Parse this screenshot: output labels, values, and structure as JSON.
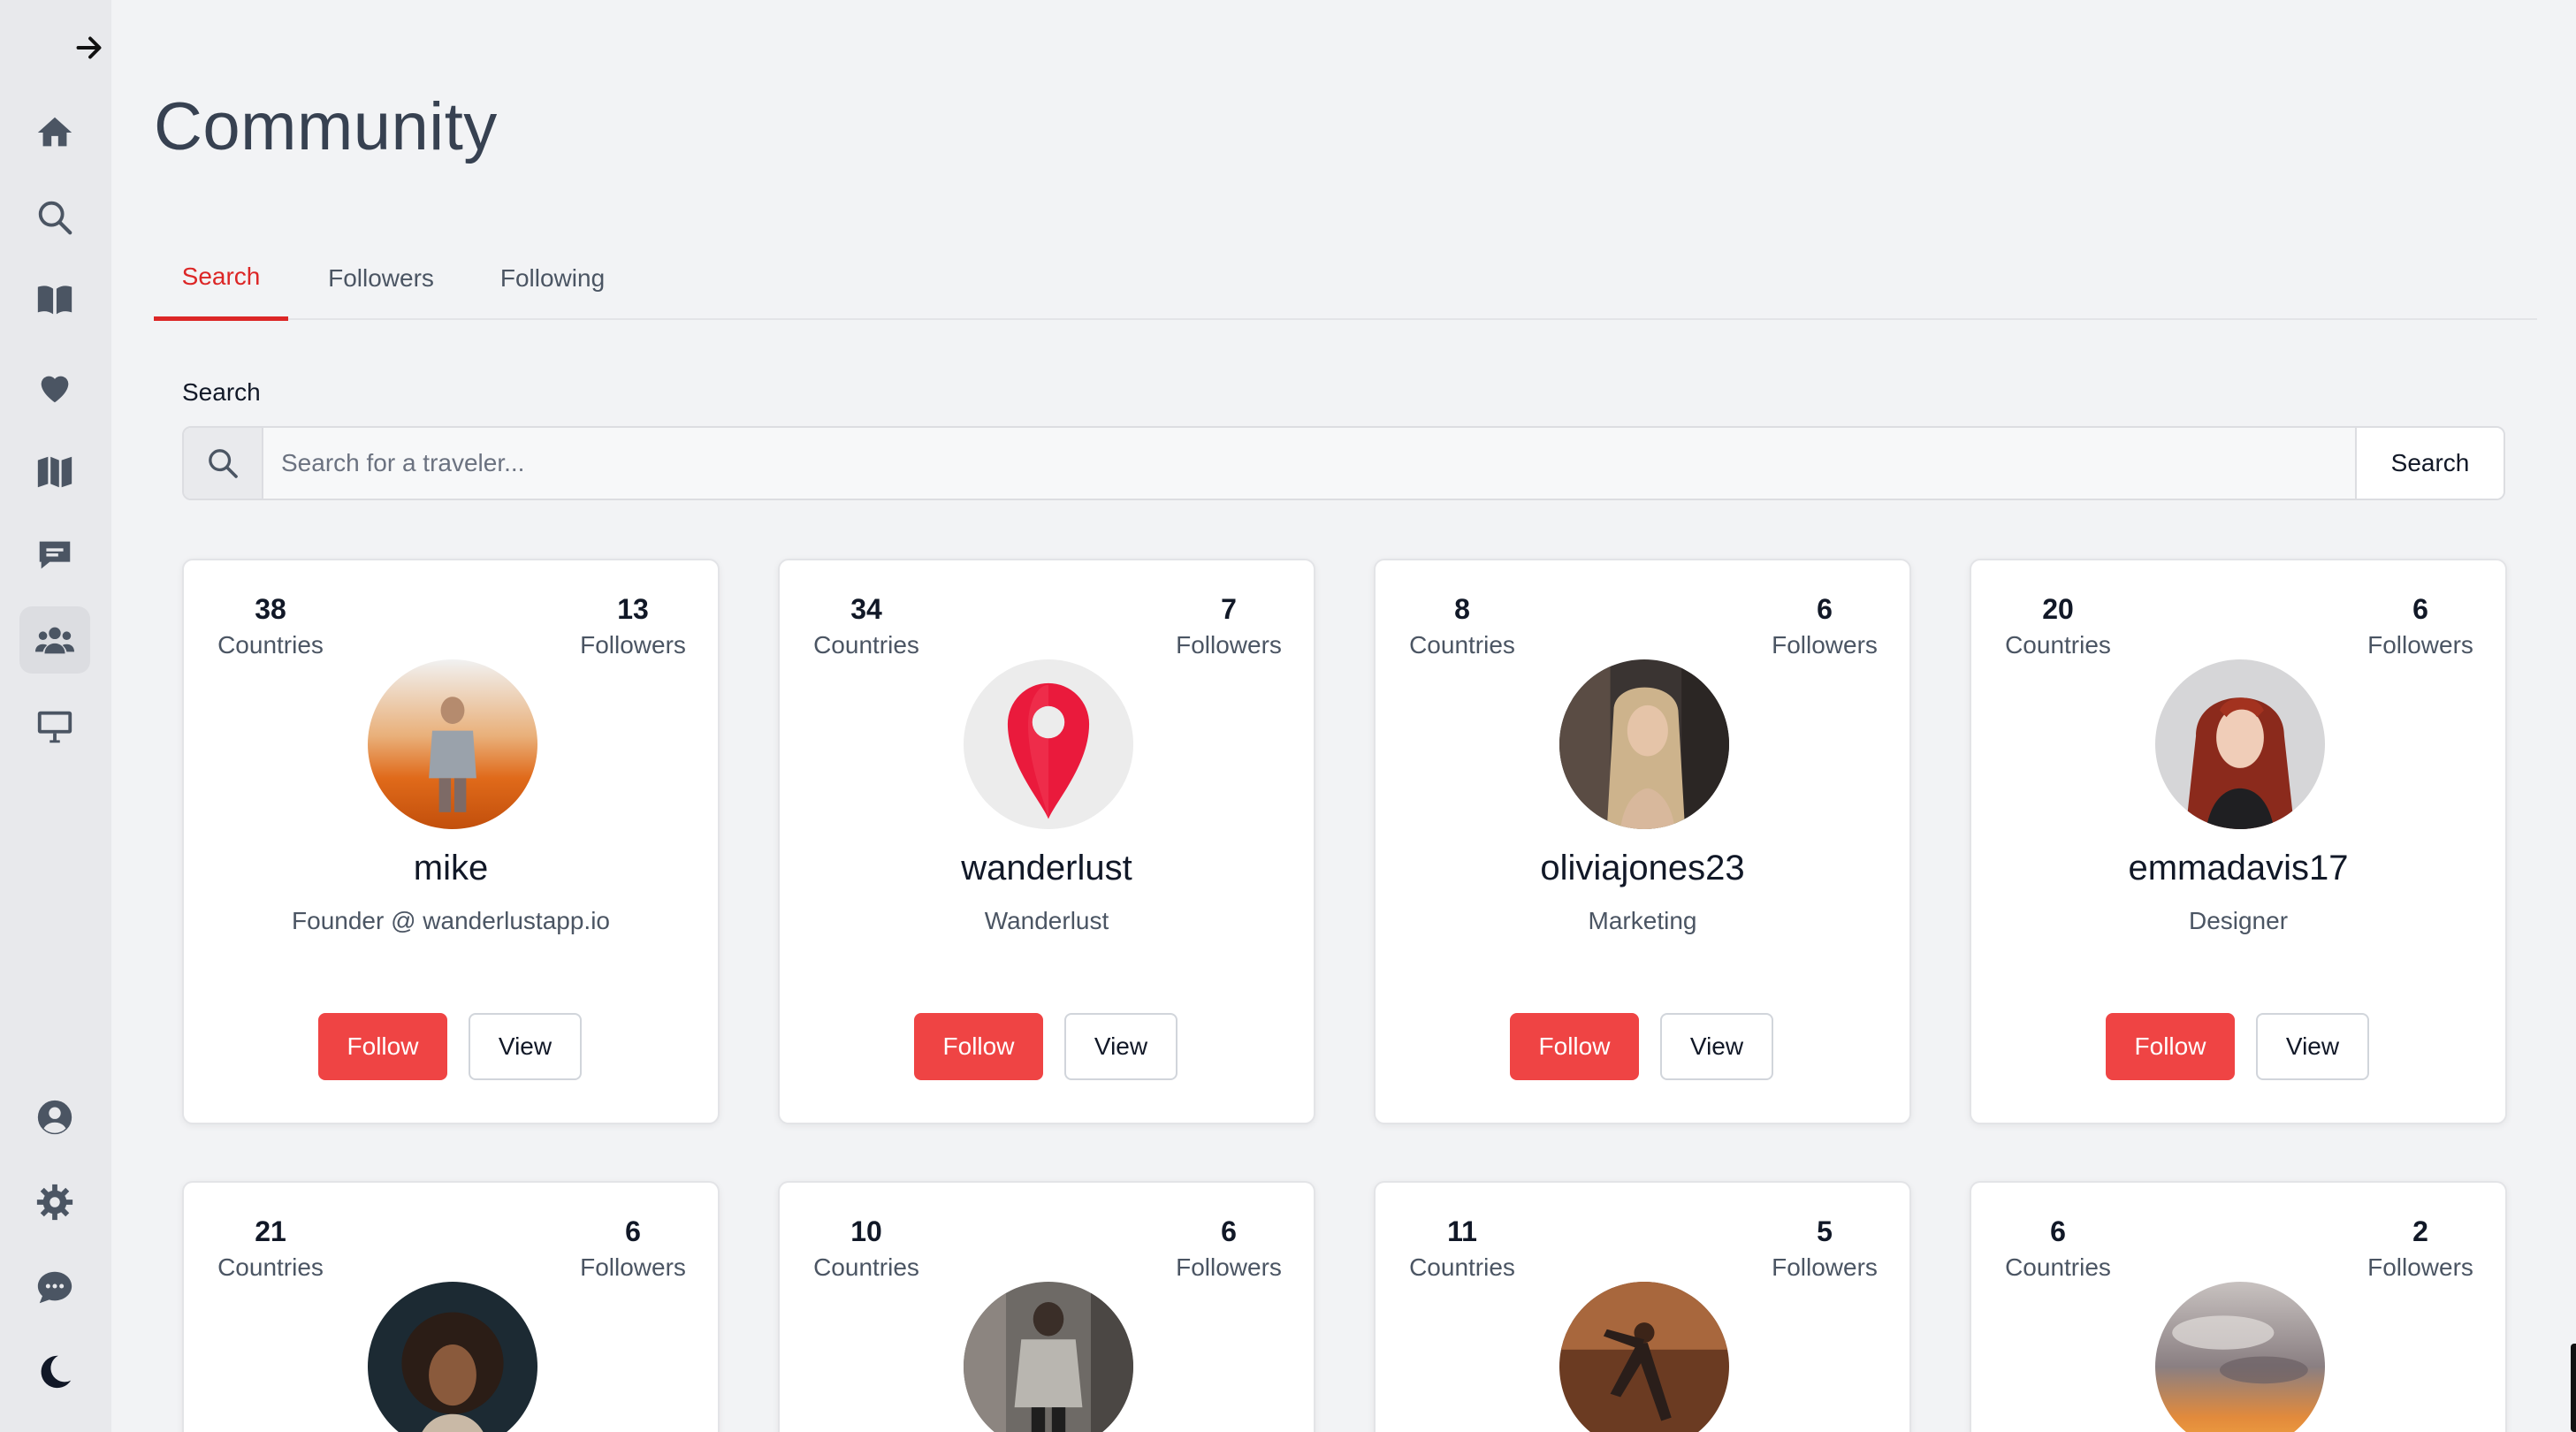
{
  "page": {
    "title": "Community"
  },
  "sidebar": {
    "nav": [
      {
        "id": "home",
        "icon": "home-icon"
      },
      {
        "id": "search",
        "icon": "search-icon"
      },
      {
        "id": "book",
        "icon": "book-open-icon"
      },
      {
        "id": "favorites",
        "icon": "heart-icon"
      },
      {
        "id": "map",
        "icon": "map-icon"
      },
      {
        "id": "messages",
        "icon": "message-icon"
      },
      {
        "id": "community",
        "icon": "users-icon",
        "active": true
      },
      {
        "id": "desktop",
        "icon": "monitor-icon"
      }
    ],
    "bottom": [
      {
        "id": "profile",
        "icon": "user-circle-icon"
      },
      {
        "id": "settings",
        "icon": "gear-icon"
      },
      {
        "id": "chat",
        "icon": "chat-bubble-icon"
      },
      {
        "id": "theme",
        "icon": "moon-icon"
      }
    ]
  },
  "tabs": [
    {
      "label": "Search",
      "active": true
    },
    {
      "label": "Followers",
      "active": false
    },
    {
      "label": "Following",
      "active": false
    }
  ],
  "search": {
    "label": "Search",
    "placeholder": "Search for a traveler...",
    "button_label": "Search"
  },
  "accent_color": "#ef4444",
  "cards": [
    {
      "countries": "38",
      "countries_label": "Countries",
      "followers": "13",
      "followers_label": "Followers",
      "username": "mike",
      "bio": "Founder @ wanderlustapp.io",
      "follow_label": "Follow",
      "view_label": "View",
      "avatar": "photo-man-desert"
    },
    {
      "countries": "34",
      "countries_label": "Countries",
      "followers": "7",
      "followers_label": "Followers",
      "username": "wanderlust",
      "bio": "Wanderlust",
      "follow_label": "Follow",
      "view_label": "View",
      "avatar": "map-pin-logo"
    },
    {
      "countries": "8",
      "countries_label": "Countries",
      "followers": "6",
      "followers_label": "Followers",
      "username": "oliviajones23",
      "bio": "Marketing",
      "follow_label": "Follow",
      "view_label": "View",
      "avatar": "photo-woman-blonde"
    },
    {
      "countries": "20",
      "countries_label": "Countries",
      "followers": "6",
      "followers_label": "Followers",
      "username": "emmadavis17",
      "bio": "Designer",
      "follow_label": "Follow",
      "view_label": "View",
      "avatar": "photo-woman-redhead"
    },
    {
      "countries": "21",
      "countries_label": "Countries",
      "followers": "6",
      "followers_label": "Followers",
      "avatar": "photo-woman-curly"
    },
    {
      "countries": "10",
      "countries_label": "Countries",
      "followers": "6",
      "followers_label": "Followers",
      "avatar": "photo-person-street"
    },
    {
      "countries": "11",
      "countries_label": "Countries",
      "followers": "5",
      "followers_label": "Followers",
      "avatar": "photo-woman-yoga"
    },
    {
      "countries": "6",
      "countries_label": "Countries",
      "followers": "2",
      "followers_label": "Followers",
      "avatar": "photo-sunset-sky"
    }
  ]
}
